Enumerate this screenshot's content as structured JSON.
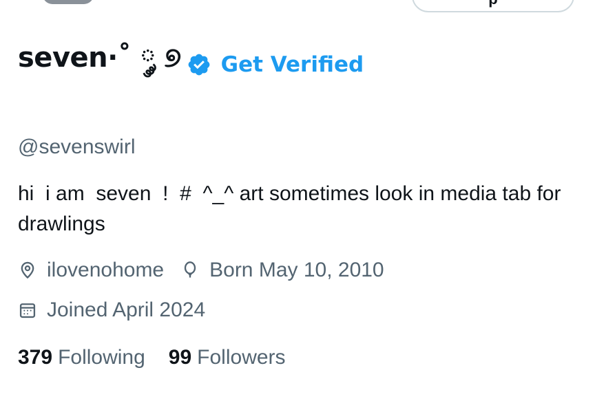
{
  "profile": {
    "display_name": "seven·˚ ༘ ୭",
    "get_verified_label": "Get Verified",
    "handle": "@sevenswirl",
    "bio": "hi  i am  seven  !  #  ^_^ art sometimes look in media tab for drawlings",
    "location": "ilovenohome",
    "birthdate": "Born May 10, 2010",
    "joined": "Joined April 2024"
  },
  "stats": {
    "following_count": "379",
    "following_label": "Following",
    "followers_count": "99",
    "followers_label": "Followers"
  },
  "header": {
    "edit_button_label": "p"
  },
  "colors": {
    "accent": "#1d9bf0",
    "secondary_text": "#536471",
    "primary_text": "#0f1419"
  },
  "icons": {
    "verified": "verified-badge-icon",
    "location": "location-pin-icon",
    "birthday": "balloon-icon",
    "joined": "calendar-icon"
  }
}
